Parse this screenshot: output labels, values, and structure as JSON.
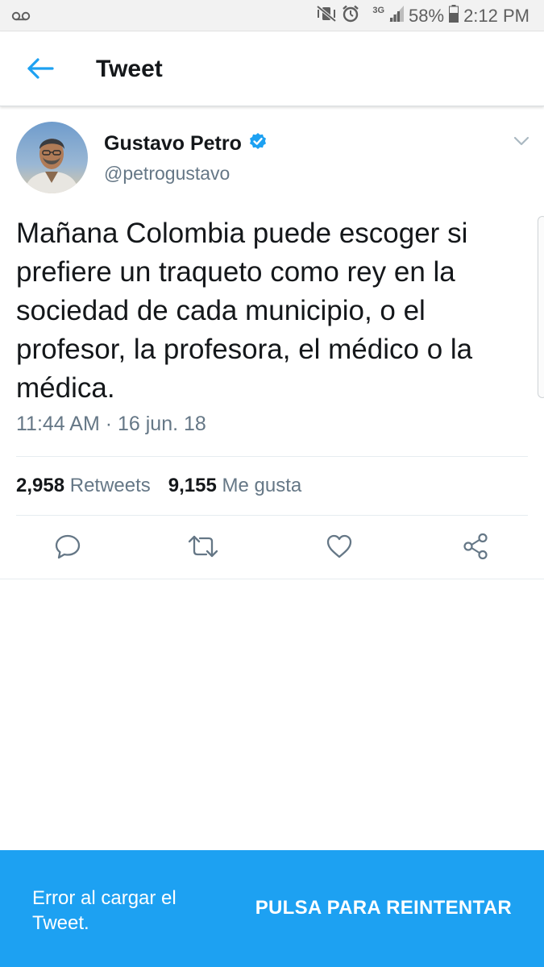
{
  "status_bar": {
    "voicemail_icon": "voicemail-icon",
    "network": "3G",
    "battery": "58%",
    "time": "2:12 PM"
  },
  "header": {
    "back_icon": "back-arrow-icon",
    "title": "Tweet"
  },
  "tweet": {
    "author_name": "Gustavo Petro",
    "verified_icon": "verified-badge-icon",
    "handle": "@petrogustavo",
    "text": "Mañana Colombia puede escoger si prefiere un traqueto como rey en la sociedad de cada municipio, o el profesor, la profesora, el médico o la médica.",
    "timestamp": "11:44 AM · 16 jun. 18",
    "retweets_count": "2,958",
    "retweets_label": "Retweets",
    "likes_count": "9,155",
    "likes_label": "Me gusta"
  },
  "actions": [
    "reply-icon",
    "retweet-icon",
    "like-icon",
    "share-icon"
  ],
  "error_banner": {
    "message": "Error al cargar el Tweet.",
    "retry_label": "PULSA PARA REINTENTAR"
  },
  "colors": {
    "accent": "#1da1f2",
    "secondary_text": "#657786",
    "primary_text": "#14171a"
  }
}
